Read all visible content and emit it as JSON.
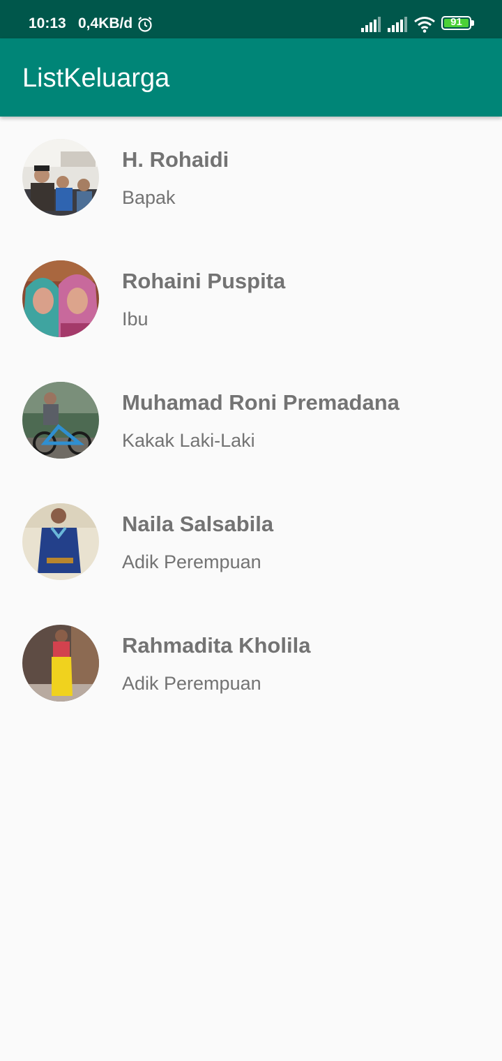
{
  "status_bar": {
    "time": "10:13",
    "network_speed": "0,4KB/d",
    "battery": "91",
    "icons": [
      "alarm-icon",
      "signal-icon",
      "signal-icon",
      "wifi-icon",
      "battery-icon"
    ]
  },
  "app_bar": {
    "title": "ListKeluarga"
  },
  "family": [
    {
      "name": "H. Rohaidi",
      "role": "Bapak"
    },
    {
      "name": "Rohaini Puspita",
      "role": "Ibu"
    },
    {
      "name": "Muhamad Roni Premadana",
      "role": "Kakak Laki-Laki"
    },
    {
      "name": "Naila Salsabila",
      "role": "Adik Perempuan"
    },
    {
      "name": "Rahmadita Kholila",
      "role": "Adik Perempuan"
    }
  ],
  "colors": {
    "status_bar": "#00574b",
    "app_bar": "#008577",
    "text": "#737373",
    "background": "#fafafa"
  }
}
